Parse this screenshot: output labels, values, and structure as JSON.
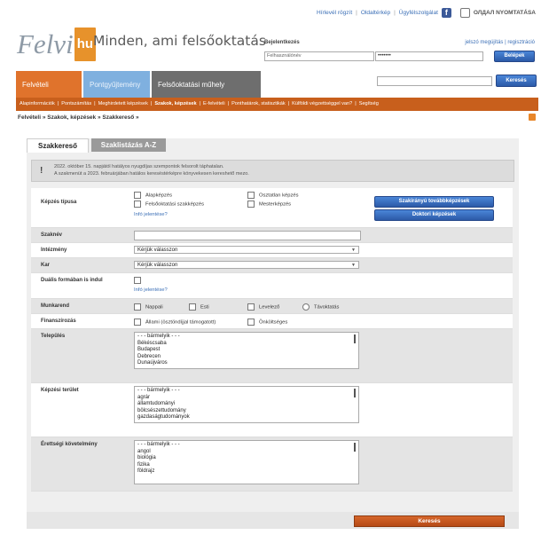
{
  "util": {
    "links": [
      "Hírlevél rögzít",
      "Oldaltérkép",
      "Ügyfélszolgálat"
    ],
    "fb": "f",
    "print_label": "ОЛДАЛ NYOMTATÁSA"
  },
  "header": {
    "logo_text": "Felvi",
    "logo_suffix": "hu",
    "slogan": "Minden, ami felsőoktatás"
  },
  "login": {
    "label": "Bejelentkezés",
    "links": "jelszó megújítás | regisztráció",
    "username_placeholder": "Felhasználónév",
    "password_value": "•••••••",
    "button": "Belépek"
  },
  "nav": {
    "tabs": [
      "Felvételi",
      "Pontgyűjtemény",
      "Felsőoktatási műhely"
    ],
    "search_button": "Keresés",
    "subnav": [
      {
        "label": "Alapinformációk",
        "bold": false
      },
      {
        "label": "Pontszámítás",
        "bold": false
      },
      {
        "label": "Meghirdetett képzések",
        "bold": false
      },
      {
        "label": "Szakok, képzések",
        "bold": true
      },
      {
        "label": "E-felvételi",
        "bold": false
      },
      {
        "label": "Ponthatárok, statisztikák",
        "bold": false
      },
      {
        "label": "Külföldi végzettséggel van?",
        "bold": false
      },
      {
        "label": "Segítség",
        "bold": false
      }
    ]
  },
  "breadcrumb": "Felvételi » Szakok, képzések » Szakkereső »",
  "form": {
    "tabs": [
      "Szakkereső",
      "Szaklistázás A-Z"
    ],
    "notice": [
      "2022. október 15. napjától hatályos nyugdíjas szempontok felsorolt táphatalan.",
      "A szakmenüt a 2023. februárjában hatálos kereséstérképre könyvekesen kereshető mezo."
    ],
    "labels": {
      "kepzes_tipus": "Képzés típusa",
      "szaknev": "Szaknév",
      "intezmeny": "Intézmény",
      "kar": "Kar",
      "dualis": "Duális formában is indul",
      "munkarend": "Munkarend",
      "finanszirozas": "Finanszírozás",
      "telepules": "Település",
      "kepzesi_terulet": "Képzési terület",
      "erettsegi": "Érettségi követelmény"
    },
    "kepzes_opts": [
      "Alapképzés",
      "Felsőoktatási szakképzés",
      "Osztatlan képzés",
      "Mesterképzés"
    ],
    "more_link": "Infó jelentése?",
    "dual_link": "Infó jelentése?",
    "btn_szakiranyu": "Szakirányú továbbképzések",
    "btn_doktori": "Doktori képzések",
    "select_placeholder": "Kérjük válasszon",
    "munkarend_opts": [
      "Nappali",
      "Esti",
      "Levelező",
      "Távoktatás"
    ],
    "finansz_opts": [
      "Állami (ösztöndíjjal támogatott)",
      "Önköltséges"
    ],
    "telepules_list": [
      "- - - bármelyik - - -",
      "Békéscsaba",
      "Budapest",
      "Debrecen",
      "Dunaújváros"
    ],
    "terulet_list": [
      "- - - bármelyik - - -",
      "agrár",
      "államtudományi",
      "bölcsészettudomány",
      "gazdaságtudományok"
    ],
    "erettsegi_list": [
      "- - - bármelyik - - -",
      "angol",
      "biológia",
      "fizika",
      "földrajz"
    ],
    "submit": "Keresés"
  }
}
